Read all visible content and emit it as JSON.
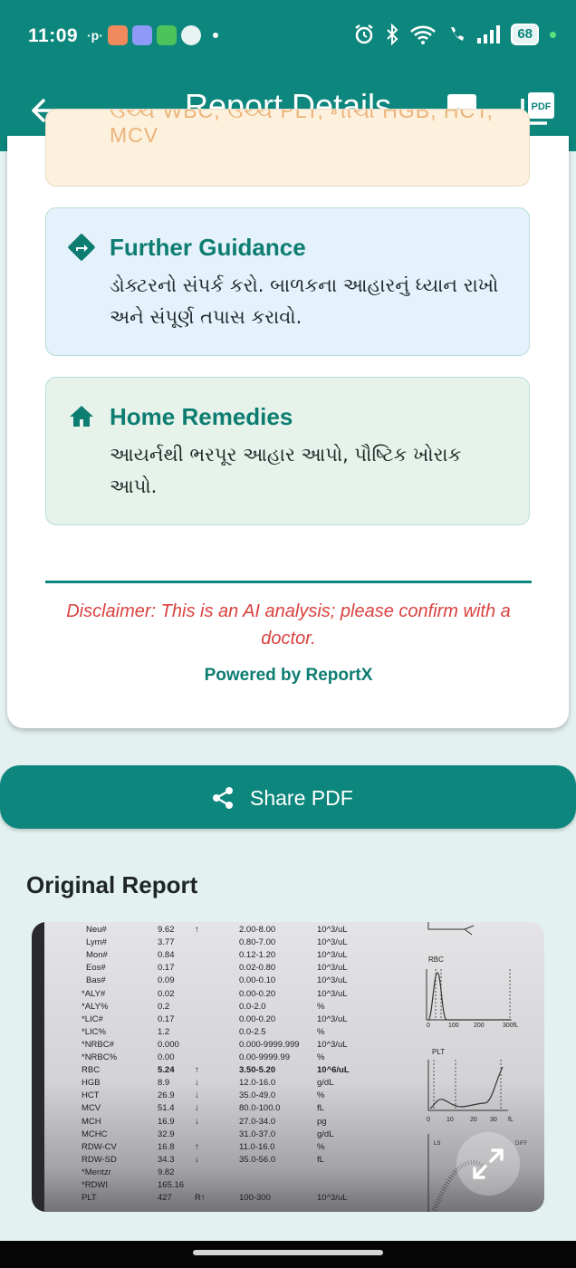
{
  "status_bar": {
    "time": "11:09",
    "battery": "68",
    "carrier_mark": "·p·"
  },
  "app_bar": {
    "title": "Report Details",
    "back_icon": "arrow-left-icon",
    "image_icon": "image-icon",
    "pdf_icon": "pdf-icon",
    "pdf_icon_text": "PDF"
  },
  "sections": {
    "partial_summary_text": "ઉચ્ચ WBC, ઉચ્ચ PLT, નીચા HGB, HCT, MCV",
    "further_guidance": {
      "heading": "Further Guidance",
      "body": "ડોક્ટરનો સંપર્ક કરો. બાળકના આહારનું ધ્યાન રાખો અને સંપૂર્ણ તપાસ કરાવો."
    },
    "home_remedies": {
      "heading": "Home Remedies",
      "body": "આયર્નથી ભરપૂર આહાર આપો, પૌષ્ટિક ખોરાક આપો."
    }
  },
  "footer": {
    "disclaimer": "Disclaimer: This is an AI analysis; please confirm with a doctor.",
    "powered_by": "Powered by ReportX"
  },
  "share_button": {
    "label": "Share PDF",
    "icon": "share-icon"
  },
  "original_report": {
    "title": "Original Report",
    "expand_icon": "expand-icon",
    "rows": [
      {
        "name": "Neu#",
        "value": "9.62",
        "flag": "↑",
        "range": "2.00-8.00",
        "unit": "10^3/uL"
      },
      {
        "name": "Lym#",
        "value": "3.77",
        "flag": "",
        "range": "0.80-7.00",
        "unit": "10^3/uL"
      },
      {
        "name": "Mon#",
        "value": "0.84",
        "flag": "",
        "range": "0.12-1.20",
        "unit": "10^3/uL"
      },
      {
        "name": "Eos#",
        "value": "0.17",
        "flag": "",
        "range": "0.02-0.80",
        "unit": "10^3/uL"
      },
      {
        "name": "Bas#",
        "value": "0.09",
        "flag": "",
        "range": "0.00-0.10",
        "unit": "10^3/uL"
      },
      {
        "name": "*ALY#",
        "value": "0.02",
        "flag": "",
        "range": "0.00-0.20",
        "unit": "10^3/uL"
      },
      {
        "name": "*ALY%",
        "value": "0.2",
        "flag": "",
        "range": "0.0-2.0",
        "unit": "%"
      },
      {
        "name": "*LIC#",
        "value": "0.17",
        "flag": "",
        "range": "0.00-0.20",
        "unit": "10^3/uL"
      },
      {
        "name": "*LIC%",
        "value": "1.2",
        "flag": "",
        "range": "0.0-2.5",
        "unit": "%"
      },
      {
        "name": "*NRBC#",
        "value": "0.000",
        "flag": "",
        "range": "0.000-9999.999",
        "unit": "10^3/uL"
      },
      {
        "name": "*NRBC%",
        "value": "0.00",
        "flag": "",
        "range": "0.00-9999.99",
        "unit": "%"
      },
      {
        "name": "RBC",
        "value": "5.24",
        "flag": "↑",
        "range": "3.50-5.20",
        "unit": "10^6/uL"
      },
      {
        "name": "HGB",
        "value": "8.9",
        "flag": "↓",
        "range": "12.0-16.0",
        "unit": "g/dL"
      },
      {
        "name": "HCT",
        "value": "26.9",
        "flag": "↓",
        "range": "35.0-49.0",
        "unit": "%"
      },
      {
        "name": "MCV",
        "value": "51.4",
        "flag": "↓",
        "range": "80.0-100.0",
        "unit": "fL"
      },
      {
        "name": "MCH",
        "value": "16.9",
        "flag": "↓",
        "range": "27.0-34.0",
        "unit": "pg"
      },
      {
        "name": "MCHC",
        "value": "32.9",
        "flag": "",
        "range": "31.0-37.0",
        "unit": "g/dL"
      },
      {
        "name": "RDW-CV",
        "value": "16.8",
        "flag": "↑",
        "range": "11.0-16.0",
        "unit": "%"
      },
      {
        "name": "RDW-SD",
        "value": "34.3",
        "flag": "↓",
        "range": "35.0-56.0",
        "unit": "fL"
      },
      {
        "name": "*Mentzr",
        "value": "9.82",
        "flag": "",
        "range": "",
        "unit": ""
      },
      {
        "name": "*RDWI",
        "value": "165.16",
        "flag": "",
        "range": "",
        "unit": ""
      },
      {
        "name": "PLT",
        "value": "427",
        "flag": "R↑",
        "range": "100-300",
        "unit": "10^3/uL"
      }
    ],
    "graph_labels": {
      "rbc": "RBC",
      "rbc_axis": [
        "0",
        "100",
        "200",
        "300fL"
      ],
      "plt": "PLT",
      "plt_axis": [
        "0",
        "10",
        "20",
        "30",
        "fL"
      ],
      "ls": "LS",
      "diff": "DIFF"
    }
  }
}
